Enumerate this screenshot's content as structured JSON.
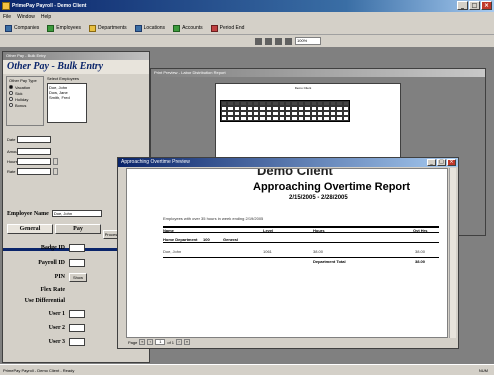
{
  "app": {
    "title": "PrimePay Payroll - Demo Client",
    "window_buttons": [
      "_",
      "□",
      "×"
    ]
  },
  "menu": [
    "File",
    "Window",
    "Help"
  ],
  "toolbar": {
    "items": [
      "Companies",
      "Employees",
      "Departments",
      "Locations",
      "Accounts",
      "Period End"
    ]
  },
  "zoom": {
    "value": "100%"
  },
  "left_window": {
    "title": "Other Pay - Bulk Entry",
    "banner": "Other Pay - Bulk Entry",
    "pay_type_group_label": "Other Pay Type",
    "pay_types": [
      "Vacation",
      "Sick",
      "Holiday",
      "Bonus"
    ],
    "selected_pay_type": "Vacation",
    "employee_list_label": "Select Employees",
    "employee_list": [
      "Doe, John",
      "Dow, Jane",
      "Smith, Fred"
    ],
    "fields": [
      {
        "label": "Date",
        "value": ""
      },
      {
        "label": "Amount",
        "value": ""
      },
      {
        "label": "Hours",
        "value": ""
      },
      {
        "label": "Rate",
        "value": ""
      }
    ],
    "process_label": "Process",
    "employee_name_label": "Employee Name",
    "employee_name_value": "Doe, John",
    "tabs": [
      "General",
      "Pay"
    ],
    "general_labels": [
      "Badge ID",
      "Payroll ID",
      "PIN",
      "Flex Rate",
      "Use Differential",
      "User 1",
      "User 2",
      "User 3"
    ],
    "badge_id": "",
    "payroll_id": "",
    "pin_button": "Show"
  },
  "print_window": {
    "title": "Print Preview - Labor Distribution Report",
    "page_header": "Demo Client"
  },
  "report_window": {
    "title": "Approaching Overtime Preview",
    "company": "Demo Client",
    "report_title": "Approaching Overtime Report",
    "date_range": "2/15/2005 - 2/28/2005",
    "subtitle": "Employees with over 35 hours in week ending 2/19/2005",
    "columns": [
      "Name",
      "Level",
      "Hours",
      "Ovt Hrs"
    ],
    "department": {
      "label": "Home Department",
      "code": "100",
      "name": "General"
    },
    "rows": [
      {
        "name": "Doe, John",
        "level": "1061",
        "hours": "38.00",
        "ovt": "38.00"
      }
    ],
    "total_label": "Department Total",
    "total_value": "38.00",
    "page_label": "Page",
    "page_number": "1",
    "page_of": "of 1"
  },
  "status": {
    "text": "PrimePay Payroll - Demo Client - Ready",
    "right": "NUM"
  }
}
